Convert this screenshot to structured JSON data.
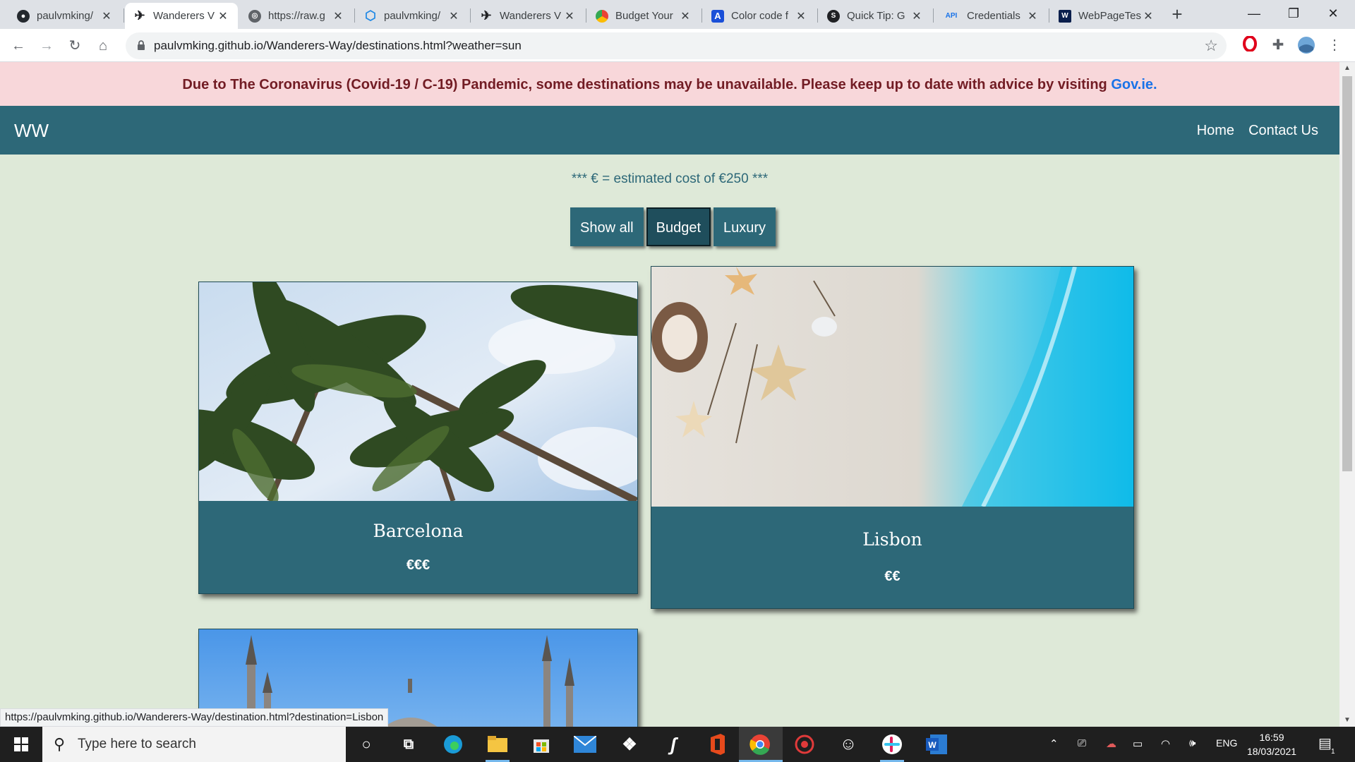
{
  "browser": {
    "tabs": [
      {
        "label": "paulvmking/",
        "icon": "github-icon",
        "active": false
      },
      {
        "label": "Wanderers V",
        "icon": "plane-icon",
        "active": true
      },
      {
        "label": "https://raw.g",
        "icon": "globe-icon",
        "active": false
      },
      {
        "label": "paulvmking/",
        "icon": "hexagon-icon",
        "active": false
      },
      {
        "label": "Wanderers V",
        "icon": "plane-icon",
        "active": false
      },
      {
        "label": "Budget Your",
        "icon": "chrome-icon",
        "active": false
      },
      {
        "label": "Color code f",
        "icon": "letter-a-icon",
        "active": false
      },
      {
        "label": "Quick Tip: G",
        "icon": "quicktip-icon",
        "active": false
      },
      {
        "label": "Credentials",
        "icon": "api-icon",
        "active": false
      },
      {
        "label": "WebPageTes",
        "icon": "webpagetest-icon",
        "active": false
      }
    ],
    "url": "paulvmking.github.io/Wanderers-Way/destinations.html?weather=sun",
    "status_url": "https://paulvmking.github.io/Wanderers-Way/destination.html?destination=Lisbon"
  },
  "alert": {
    "text": "Due to The Coronavirus (Covid-19 / C-19) Pandemic, some destinations may be unavailable. Please keep up to date with advice by visiting ",
    "link": "Gov.ie."
  },
  "nav": {
    "brand": "WW",
    "links": [
      "Home",
      "Contact Us"
    ]
  },
  "legend": "*** € = estimated cost of €250 ***",
  "filters": [
    {
      "label": "Show all",
      "active": false
    },
    {
      "label": "Budget",
      "active": true
    },
    {
      "label": "Luxury",
      "active": false
    }
  ],
  "cards": [
    {
      "name": "Barcelona",
      "price": "€€€",
      "image": "palm-trees"
    },
    {
      "name": "Lisbon",
      "price": "€€",
      "image": "beach-starfish"
    },
    {
      "name": "",
      "price": "",
      "image": "mosque-domes"
    }
  ],
  "taskbar": {
    "search_placeholder": "Type here to search",
    "language": "ENG",
    "time": "16:59",
    "date": "18/03/2021",
    "notification_count": "1"
  },
  "colors": {
    "primary": "#2d6878",
    "page_bg": "#dee9d8",
    "alert_bg": "#f8d7da",
    "alert_text": "#721c24"
  }
}
